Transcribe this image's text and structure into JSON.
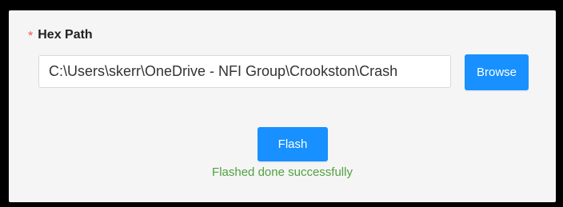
{
  "form": {
    "required_mark": "*",
    "hex_path_label": "Hex Path",
    "hex_path_value": "C:\\Users\\skerr\\OneDrive - NFI Group\\Crookston\\Crash",
    "browse_label": "Browse",
    "flash_label": "Flash",
    "status_message": "Flashed done successfully"
  },
  "colors": {
    "primary": "#1890ff",
    "success": "#52a042",
    "required": "#ff4d4f",
    "panel_background": "#f5f5f5"
  }
}
